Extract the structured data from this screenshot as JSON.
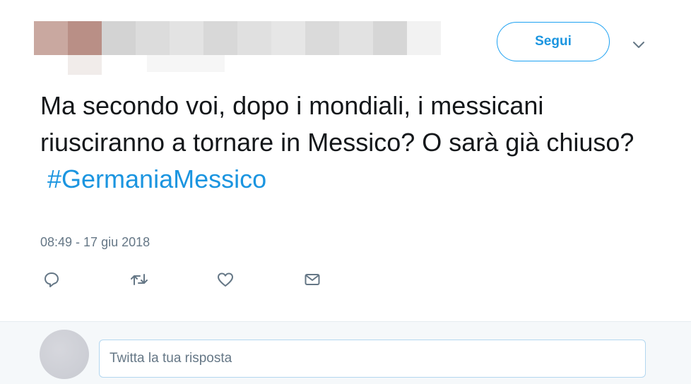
{
  "header": {
    "follow_label": "Segui",
    "caret_icon": "chevron-down-icon"
  },
  "tweet": {
    "text": "Ma secondo voi, dopo i mondiali, i messicani riusciranno a tornare in Messico? O sarà già chiuso?",
    "hashtag": "#GermaniaMessico",
    "timestamp": "08:49 - 17 giu 2018"
  },
  "actions": [
    {
      "name": "reply-icon"
    },
    {
      "name": "retweet-icon"
    },
    {
      "name": "like-icon"
    },
    {
      "name": "direct-message-icon"
    }
  ],
  "reply": {
    "placeholder": "Twitta la tua risposta"
  },
  "colors": {
    "accent": "#1da1f2",
    "link": "#1b95e0",
    "text": "#14171a",
    "muted": "#657786",
    "reply_bg": "#f5f8fa"
  }
}
